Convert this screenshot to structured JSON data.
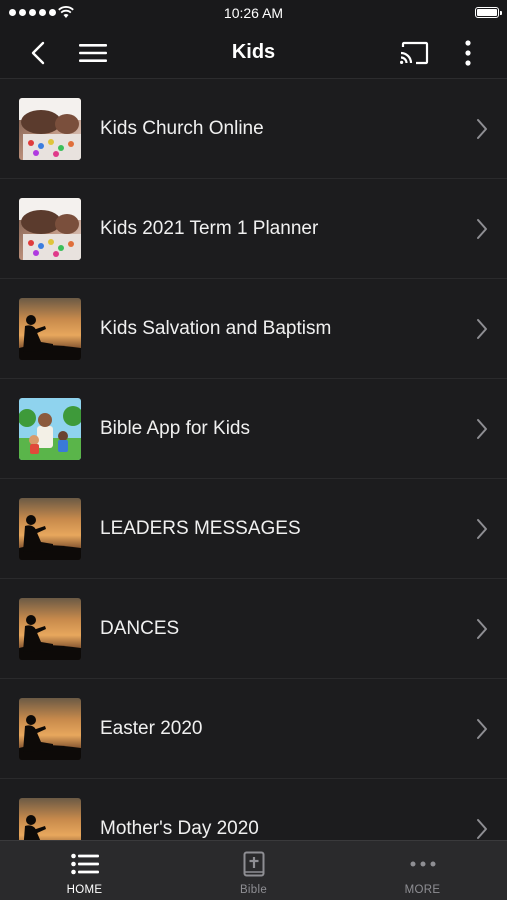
{
  "status_bar": {
    "time": "10:26 AM"
  },
  "nav": {
    "title": "Kids"
  },
  "list": [
    {
      "label": "Kids Church Online",
      "thumbnail": "kids-game-photo"
    },
    {
      "label": "Kids 2021 Term 1 Planner",
      "thumbnail": "kids-game-photo"
    },
    {
      "label": "Kids Salvation and Baptism",
      "thumbnail": "sunset-reading-silhouette"
    },
    {
      "label": "Bible App for Kids",
      "thumbnail": "cartoon-kids-illustration"
    },
    {
      "label": "LEADERS MESSAGES",
      "thumbnail": "sunset-reading-silhouette"
    },
    {
      "label": "DANCES",
      "thumbnail": "sunset-reading-silhouette"
    },
    {
      "label": "Easter 2020",
      "thumbnail": "sunset-reading-silhouette"
    },
    {
      "label": "Mother's Day 2020",
      "thumbnail": "sunset-reading-silhouette"
    }
  ],
  "tabs": [
    {
      "label": "HOME",
      "icon": "list-icon",
      "active": true
    },
    {
      "label": "Bible",
      "icon": "bible-icon",
      "active": false
    },
    {
      "label": "MORE",
      "icon": "more-dots-icon",
      "active": false
    }
  ],
  "colors": {
    "background": "#1c1c1e",
    "bar": "#19191b",
    "tab_bar": "#2a2a2c",
    "inactive": "#8e8e93"
  }
}
